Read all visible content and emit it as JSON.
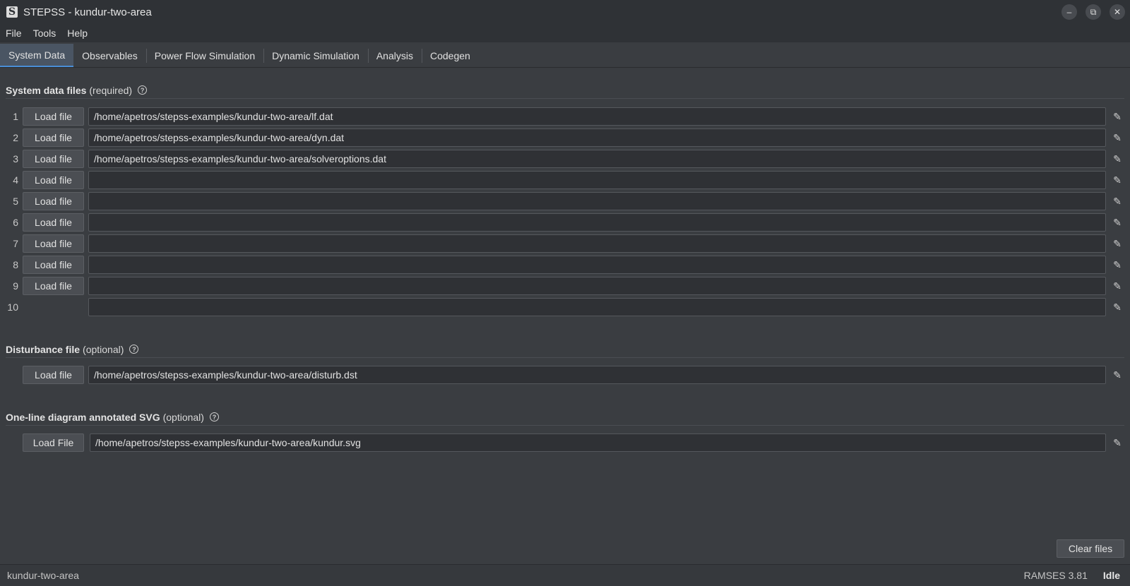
{
  "window": {
    "title": "STEPSS - kundur-two-area",
    "app_icon": "S",
    "controls": [
      "minimize-icon",
      "restore-icon",
      "close-icon"
    ]
  },
  "menu": [
    "File",
    "Tools",
    "Help"
  ],
  "tabs": [
    "System Data",
    "Observables",
    "Power Flow Simulation",
    "Dynamic Simulation",
    "Analysis",
    "Codegen"
  ],
  "active_tab": "System Data",
  "system_files": {
    "title": "System data files",
    "qualifier": "(required)",
    "rows": [
      {
        "num": "1",
        "button": "Load file",
        "path": "/home/apetros/stepss-examples/kundur-two-area/lf.dat"
      },
      {
        "num": "2",
        "button": "Load file",
        "path": "/home/apetros/stepss-examples/kundur-two-area/dyn.dat"
      },
      {
        "num": "3",
        "button": "Load file",
        "path": "/home/apetros/stepss-examples/kundur-two-area/solveroptions.dat"
      },
      {
        "num": "4",
        "button": "Load file",
        "path": ""
      },
      {
        "num": "5",
        "button": "Load file",
        "path": ""
      },
      {
        "num": "6",
        "button": "Load file",
        "path": ""
      },
      {
        "num": "7",
        "button": "Load file",
        "path": ""
      },
      {
        "num": "8",
        "button": "Load file",
        "path": ""
      },
      {
        "num": "9",
        "button": "Load file",
        "path": ""
      },
      {
        "num": "10",
        "button": "",
        "path": ""
      }
    ]
  },
  "disturbance": {
    "title": "Disturbance file",
    "qualifier": "(optional)",
    "button": "Load file",
    "path": "/home/apetros/stepss-examples/kundur-two-area/disturb.dst"
  },
  "svg": {
    "title": "One-line diagram annotated SVG",
    "qualifier": "(optional)",
    "button": "Load File",
    "path": "/home/apetros/stepss-examples/kundur-two-area/kundur.svg"
  },
  "clear_button": "Clear files",
  "status": {
    "project": "kundur-two-area",
    "engine": "RAMSES 3.81",
    "state": "Idle"
  }
}
